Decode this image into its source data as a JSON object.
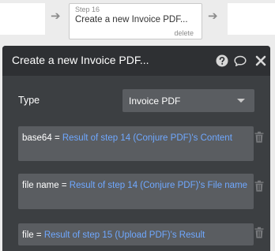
{
  "workflow": {
    "step": {
      "number_label": "Step 16",
      "title": "Create a new Invoice PDF...",
      "delete_label": "delete"
    },
    "arrow_glyph": "➔"
  },
  "editor": {
    "title": "Create a new Invoice PDF...",
    "icons": [
      "help-circle-icon",
      "comment-icon",
      "close-icon"
    ],
    "type_label": "Type",
    "type_value": "Invoice PDF",
    "params": [
      {
        "key": "base64",
        "eq": "=",
        "expression": "Result of step 14 (Conjure PDF)'s Content"
      },
      {
        "key": "file name",
        "eq": "=",
        "expression": "Result of step 14 (Conjure PDF)'s File name"
      },
      {
        "key": "file",
        "eq": "=",
        "expression": "Result of step 15 (Upload PDF)'s Result"
      }
    ]
  },
  "colors": {
    "panel_bg": "#3c3f42",
    "header_bg": "#2e3033",
    "field_bg": "#5a5d61",
    "expression_blue": "#6fa8ff"
  }
}
